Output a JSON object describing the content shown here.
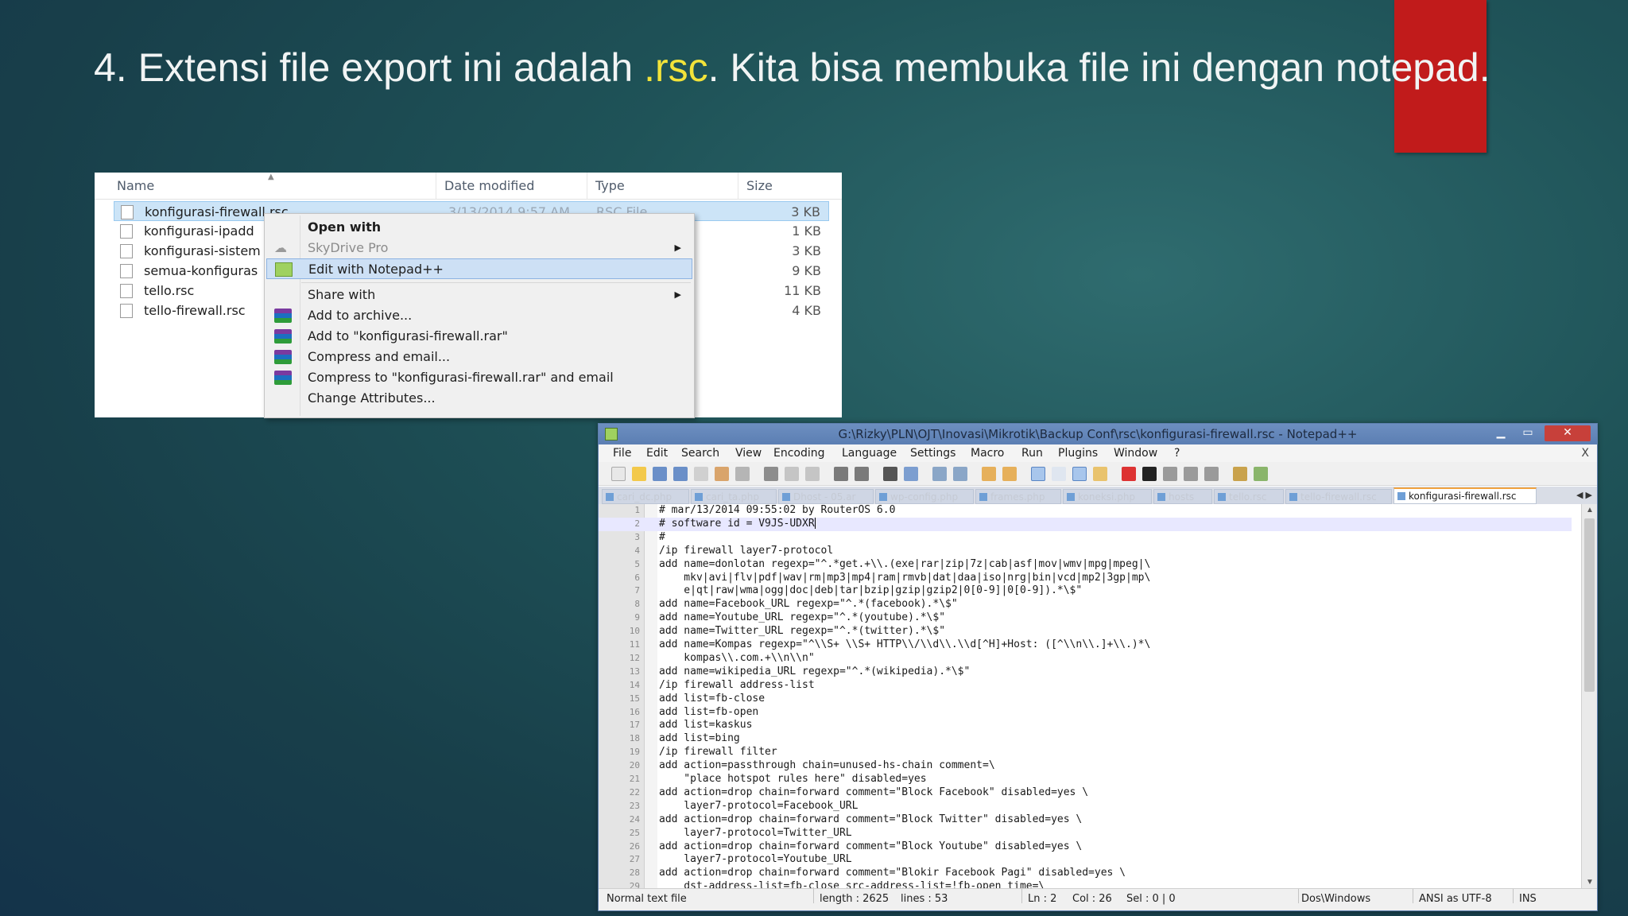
{
  "slide": {
    "title_prefix": "4. Extensi file export ini adalah ",
    "title_highlight": ".rsc",
    "title_suffix": ". Kita bisa membuka file ini dengan notepad.",
    "highlight_color": "#f2e33a",
    "accent_color": "#c11b1b"
  },
  "explorer": {
    "columns": {
      "name": "Name",
      "date": "Date modified",
      "type": "Type",
      "size": "Size"
    },
    "selected_date": "3/13/2014 9:57 AM",
    "selected_type": "RSC File",
    "files": [
      {
        "name": "konfigurasi-firewall.rsc",
        "size": "3 KB"
      },
      {
        "name": "konfigurasi-ipadd",
        "size": "1 KB"
      },
      {
        "name": "konfigurasi-sistem",
        "size": "3 KB"
      },
      {
        "name": "semua-konfiguras",
        "size": "9 KB"
      },
      {
        "name": "tello.rsc",
        "size": "11 KB"
      },
      {
        "name": "tello-firewall.rsc",
        "size": "4 KB"
      }
    ]
  },
  "context_menu": {
    "items": [
      {
        "label": "Open with"
      },
      {
        "label": "SkyDrive Pro"
      },
      {
        "label": "Edit with Notepad++"
      },
      {
        "label": "Share with"
      },
      {
        "label": "Add to archive..."
      },
      {
        "label": "Add to \"konfigurasi-firewall.rar\""
      },
      {
        "label": "Compress and email..."
      },
      {
        "label": "Compress to \"konfigurasi-firewall.rar\" and email"
      },
      {
        "label": "Change Attributes..."
      }
    ]
  },
  "notepad": {
    "title": "G:\\Rizky\\PLN\\OJT\\Inovasi\\Mikrotik\\Backup Conf\\rsc\\konfigurasi-firewall.rsc - Notepad++",
    "menu": [
      "File",
      "Edit",
      "Search",
      "View",
      "Encoding",
      "Language",
      "Settings",
      "Macro",
      "Run",
      "Plugins",
      "Window",
      "?"
    ],
    "menu_close": "X",
    "tabs": [
      "cari_dc.php",
      "cari_ta.php",
      "Dhost - 05.ar",
      "wp-config.php",
      "frames.php",
      "koneksi.php",
      "hosts",
      "tello.rsc",
      "tello-firewall.rsc",
      "konfigurasi-firewall.rsc"
    ],
    "active_tab": "konfigurasi-firewall.rsc",
    "lines": [
      "# mar/13/2014 09:55:02 by RouterOS 6.0",
      "# software id = V9JS-UDXR",
      "#",
      "/ip firewall layer7-protocol",
      "add name=donlotan regexp=\"^.*get.+\\\\.(exe|rar|zip|7z|cab|asf|mov|wmv|mpg|mpeg|\\",
      "    mkv|avi|flv|pdf|wav|rm|mp3|mp4|ram|rmvb|dat|daa|iso|nrg|bin|vcd|mp2|3gp|mp\\",
      "    e|qt|raw|wma|ogg|doc|deb|tar|bzip|gzip|gzip2|0[0-9]|0[0-9]).*\\$\"",
      "add name=Facebook_URL regexp=\"^.*(facebook).*\\$\"",
      "add name=Youtube_URL regexp=\"^.*(youtube).*\\$\"",
      "add name=Twitter_URL regexp=\"^.*(twitter).*\\$\"",
      "add name=Kompas regexp=\"^\\\\S+ \\\\S+ HTTP\\\\/\\\\d\\\\.\\\\d[^H]+Host: ([^\\\\n\\\\.]+\\\\.)*\\",
      "    kompas\\\\.com.+\\\\n\\\\n\"",
      "add name=wikipedia_URL regexp=\"^.*(wikipedia).*\\$\"",
      "/ip firewall address-list",
      "add list=fb-close",
      "add list=fb-open",
      "add list=kaskus",
      "add list=bing",
      "/ip firewall filter",
      "add action=passthrough chain=unused-hs-chain comment=\\",
      "    \"place hotspot rules here\" disabled=yes",
      "add action=drop chain=forward comment=\"Block Facebook\" disabled=yes \\",
      "    layer7-protocol=Facebook_URL",
      "add action=drop chain=forward comment=\"Block Twitter\" disabled=yes \\",
      "    layer7-protocol=Twitter_URL",
      "add action=drop chain=forward comment=\"Block Youtube\" disabled=yes \\",
      "    layer7-protocol=Youtube_URL",
      "add action=drop chain=forward comment=\"Blokir Facebook Pagi\" disabled=yes \\",
      "    dst-address-list=fb-close src-address-list=!fb-open time=\\"
    ],
    "current_line": 2,
    "status": {
      "type": "Normal text file",
      "length": "length : 2625",
      "lines": "lines : 53",
      "ln": "Ln : 2",
      "col": "Col : 26",
      "sel": "Sel : 0 | 0",
      "eol": "Dos\\Windows",
      "encoding": "ANSI as UTF-8",
      "mode": "INS"
    }
  }
}
